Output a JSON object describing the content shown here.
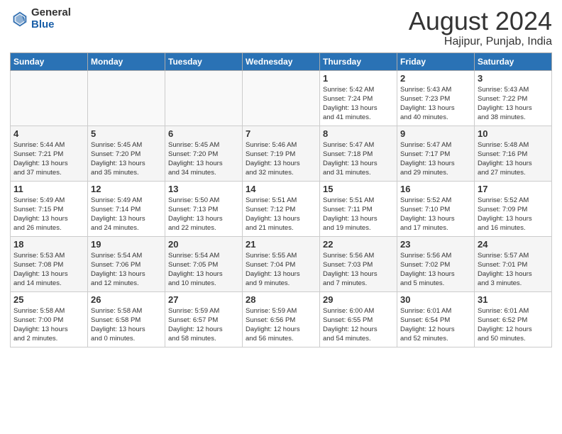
{
  "logo": {
    "general": "General",
    "blue": "Blue"
  },
  "title": "August 2024",
  "location": "Hajipur, Punjab, India",
  "days_of_week": [
    "Sunday",
    "Monday",
    "Tuesday",
    "Wednesday",
    "Thursday",
    "Friday",
    "Saturday"
  ],
  "weeks": [
    [
      {
        "day": "",
        "info": ""
      },
      {
        "day": "",
        "info": ""
      },
      {
        "day": "",
        "info": ""
      },
      {
        "day": "",
        "info": ""
      },
      {
        "day": "1",
        "info": "Sunrise: 5:42 AM\nSunset: 7:24 PM\nDaylight: 13 hours\nand 41 minutes."
      },
      {
        "day": "2",
        "info": "Sunrise: 5:43 AM\nSunset: 7:23 PM\nDaylight: 13 hours\nand 40 minutes."
      },
      {
        "day": "3",
        "info": "Sunrise: 5:43 AM\nSunset: 7:22 PM\nDaylight: 13 hours\nand 38 minutes."
      }
    ],
    [
      {
        "day": "4",
        "info": "Sunrise: 5:44 AM\nSunset: 7:21 PM\nDaylight: 13 hours\nand 37 minutes."
      },
      {
        "day": "5",
        "info": "Sunrise: 5:45 AM\nSunset: 7:20 PM\nDaylight: 13 hours\nand 35 minutes."
      },
      {
        "day": "6",
        "info": "Sunrise: 5:45 AM\nSunset: 7:20 PM\nDaylight: 13 hours\nand 34 minutes."
      },
      {
        "day": "7",
        "info": "Sunrise: 5:46 AM\nSunset: 7:19 PM\nDaylight: 13 hours\nand 32 minutes."
      },
      {
        "day": "8",
        "info": "Sunrise: 5:47 AM\nSunset: 7:18 PM\nDaylight: 13 hours\nand 31 minutes."
      },
      {
        "day": "9",
        "info": "Sunrise: 5:47 AM\nSunset: 7:17 PM\nDaylight: 13 hours\nand 29 minutes."
      },
      {
        "day": "10",
        "info": "Sunrise: 5:48 AM\nSunset: 7:16 PM\nDaylight: 13 hours\nand 27 minutes."
      }
    ],
    [
      {
        "day": "11",
        "info": "Sunrise: 5:49 AM\nSunset: 7:15 PM\nDaylight: 13 hours\nand 26 minutes."
      },
      {
        "day": "12",
        "info": "Sunrise: 5:49 AM\nSunset: 7:14 PM\nDaylight: 13 hours\nand 24 minutes."
      },
      {
        "day": "13",
        "info": "Sunrise: 5:50 AM\nSunset: 7:13 PM\nDaylight: 13 hours\nand 22 minutes."
      },
      {
        "day": "14",
        "info": "Sunrise: 5:51 AM\nSunset: 7:12 PM\nDaylight: 13 hours\nand 21 minutes."
      },
      {
        "day": "15",
        "info": "Sunrise: 5:51 AM\nSunset: 7:11 PM\nDaylight: 13 hours\nand 19 minutes."
      },
      {
        "day": "16",
        "info": "Sunrise: 5:52 AM\nSunset: 7:10 PM\nDaylight: 13 hours\nand 17 minutes."
      },
      {
        "day": "17",
        "info": "Sunrise: 5:52 AM\nSunset: 7:09 PM\nDaylight: 13 hours\nand 16 minutes."
      }
    ],
    [
      {
        "day": "18",
        "info": "Sunrise: 5:53 AM\nSunset: 7:08 PM\nDaylight: 13 hours\nand 14 minutes."
      },
      {
        "day": "19",
        "info": "Sunrise: 5:54 AM\nSunset: 7:06 PM\nDaylight: 13 hours\nand 12 minutes."
      },
      {
        "day": "20",
        "info": "Sunrise: 5:54 AM\nSunset: 7:05 PM\nDaylight: 13 hours\nand 10 minutes."
      },
      {
        "day": "21",
        "info": "Sunrise: 5:55 AM\nSunset: 7:04 PM\nDaylight: 13 hours\nand 9 minutes."
      },
      {
        "day": "22",
        "info": "Sunrise: 5:56 AM\nSunset: 7:03 PM\nDaylight: 13 hours\nand 7 minutes."
      },
      {
        "day": "23",
        "info": "Sunrise: 5:56 AM\nSunset: 7:02 PM\nDaylight: 13 hours\nand 5 minutes."
      },
      {
        "day": "24",
        "info": "Sunrise: 5:57 AM\nSunset: 7:01 PM\nDaylight: 13 hours\nand 3 minutes."
      }
    ],
    [
      {
        "day": "25",
        "info": "Sunrise: 5:58 AM\nSunset: 7:00 PM\nDaylight: 13 hours\nand 2 minutes."
      },
      {
        "day": "26",
        "info": "Sunrise: 5:58 AM\nSunset: 6:58 PM\nDaylight: 13 hours\nand 0 minutes."
      },
      {
        "day": "27",
        "info": "Sunrise: 5:59 AM\nSunset: 6:57 PM\nDaylight: 12 hours\nand 58 minutes."
      },
      {
        "day": "28",
        "info": "Sunrise: 5:59 AM\nSunset: 6:56 PM\nDaylight: 12 hours\nand 56 minutes."
      },
      {
        "day": "29",
        "info": "Sunrise: 6:00 AM\nSunset: 6:55 PM\nDaylight: 12 hours\nand 54 minutes."
      },
      {
        "day": "30",
        "info": "Sunrise: 6:01 AM\nSunset: 6:54 PM\nDaylight: 12 hours\nand 52 minutes."
      },
      {
        "day": "31",
        "info": "Sunrise: 6:01 AM\nSunset: 6:52 PM\nDaylight: 12 hours\nand 50 minutes."
      }
    ]
  ]
}
